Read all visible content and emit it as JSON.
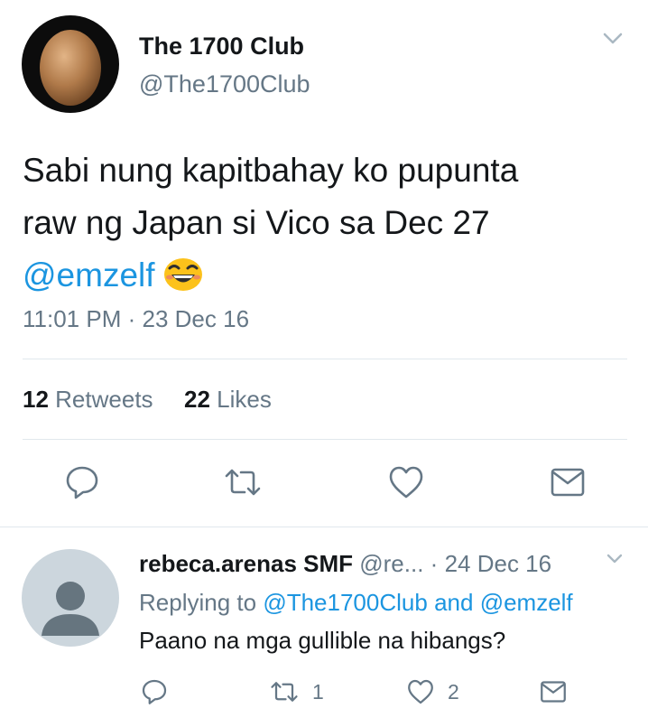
{
  "tweet": {
    "name": "The 1700 Club",
    "handle": "@The1700Club",
    "text_line1": "Sabi nung kapitbahay ko pupunta",
    "text_line2": "raw ng Japan si Vico sa Dec 27",
    "mention": "@emzelf",
    "emoji": "smiling-face-emoji",
    "time": "11:01 PM",
    "separator": "·",
    "date": "23 Dec 16",
    "retweets_count": "12",
    "retweets_label": "Retweets",
    "likes_count": "22",
    "likes_label": "Likes"
  },
  "reply": {
    "name": "rebeca.arenas SMF",
    "handle": "@re...",
    "separator": "·",
    "date": "24 Dec 16",
    "replying_label": "Replying to",
    "replying_to_1": "@The1700Club",
    "replying_and": "and",
    "replying_to_2": "@emzelf",
    "text": "Paano na mga gullible na hibangs?",
    "retweet_count": "1",
    "like_count": "2"
  },
  "colors": {
    "link": "#1b95e0",
    "secondary_text": "#657786",
    "primary_text": "#14171a",
    "divider": "#e1e8ed",
    "egg": "#b07a4a"
  }
}
